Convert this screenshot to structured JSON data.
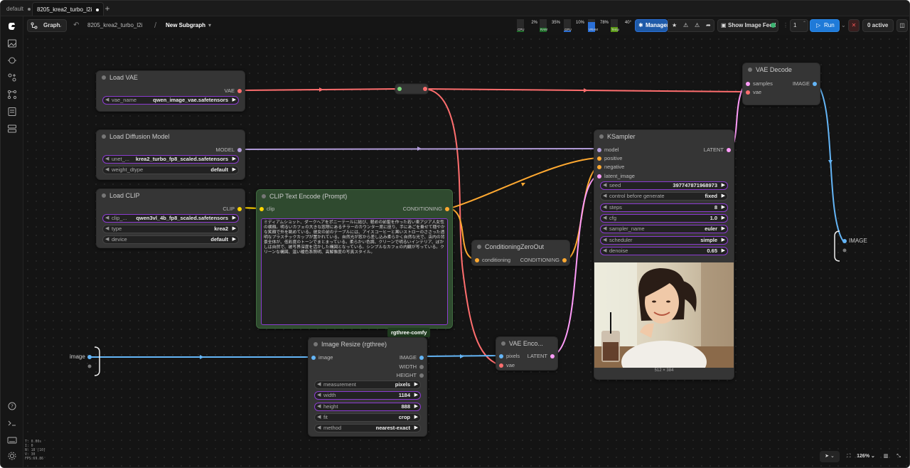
{
  "tabs": [
    {
      "label": "default",
      "active": false
    },
    {
      "label": "8205_krea2_turbo_l2i",
      "active": true
    }
  ],
  "toolbar": {
    "graph_label": "Graph",
    "workflow_name": "8205_krea2_turbo_l2i",
    "separator": "/",
    "subgraph_label": "New Subgraph",
    "resources": [
      {
        "name": "CPU",
        "pct": "2%",
        "color": "#1f6b2a",
        "level": 0.02
      },
      {
        "name": "RAM",
        "pct": "35%",
        "color": "#1f6b2a",
        "level": 0.35
      },
      {
        "name": "GPU",
        "pct": "10%",
        "color": "#2a6fd6",
        "level": 0.1
      },
      {
        "name": "VRAM",
        "pct": "78%",
        "color": "#2a6fd6",
        "level": 0.78
      },
      {
        "name": "Temp",
        "pct": "40°",
        "color": "#5c9a18",
        "level": 0.4
      }
    ],
    "manager_label": "Manager",
    "image_feed_label": "Show Image Feed",
    "batch_value": "1",
    "run_label": "Run",
    "active_label": "0 active"
  },
  "nodes": {
    "load_vae": {
      "title": "Load VAE",
      "out": "VAE",
      "widgets": [
        {
          "name": "vae_name",
          "value": "qwen_image_vae.safetensors"
        }
      ]
    },
    "load_diffusion": {
      "title": "Load Diffusion Model",
      "out": "MODEL",
      "widgets": [
        {
          "name": "unet_...",
          "value": "krea2_turbo_fp8_scaled.safetensors"
        },
        {
          "name": "weight_dtype",
          "value": "default"
        }
      ]
    },
    "load_clip": {
      "title": "Load CLIP",
      "out": "CLIP",
      "widgets": [
        {
          "name": "clip_...",
          "value": "qwen3vl_4b_fp8_scaled.safetensors"
        },
        {
          "name": "type",
          "value": "krea2"
        },
        {
          "name": "device",
          "value": "default"
        }
      ]
    },
    "clip_text": {
      "title": "CLIP Text Encode (Prompt)",
      "in": "clip",
      "out": "CONDITIONING",
      "text": "ミディアムショット、ダークヘアをポニーテールに結び、軽めの前髪を作った若い東アジア人女性の横顔。明るいカフェの大きな窓際にあるチラーのカウンター席に座り、手にあごを乗せて穏やかな笑顔で外を眺めている。彼女の前のテーブルには、アイスコーヒーと黒いストローのささった透明なプラスチックカップが置かれている。自然光が窓から差し込み柔らかく自然な光で、店内の背景全体が、低彩度のトーンでまとまっている。柔らかい色調、クリーンで明るいインテリア、ぼかしは自然で、被写界深度を活かした構図となっている。シンプルなカフェの内観が写っている。クリーンな構図、温い暖色系照明、高解像度の写真スタイル。",
      "badge": "rgthree-comfy"
    },
    "zero_out": {
      "title": "ConditioningZeroOut",
      "in": "conditioning",
      "out": "CONDITIONING"
    },
    "ksampler": {
      "title": "KSampler",
      "inputs": [
        "model",
        "positive",
        "negative",
        "latent_image"
      ],
      "out": "LATENT",
      "widgets": [
        {
          "name": "seed",
          "value": "397747871968973"
        },
        {
          "name": "control before generate",
          "value": "fixed"
        },
        {
          "name": "steps",
          "value": "8"
        },
        {
          "name": "cfg",
          "value": "1.0"
        },
        {
          "name": "sampler_name",
          "value": "euler"
        },
        {
          "name": "scheduler",
          "value": "simple"
        },
        {
          "name": "denoise",
          "value": "0.65"
        }
      ],
      "preview_size": "512 × 384"
    },
    "vae_decode": {
      "title": "VAE Decode",
      "inputs": [
        "samples",
        "vae"
      ],
      "out": "IMAGE"
    },
    "vae_encode": {
      "title": "VAE Enco...",
      "inputs": [
        "pixels",
        "vae"
      ],
      "out": "LATENT"
    },
    "image_resize": {
      "title": "Image Resize (rgthree)",
      "in": "image",
      "outs": [
        "IMAGE",
        "WIDTH",
        "HEIGHT"
      ],
      "widgets": [
        {
          "name": "measurement",
          "value": "pixels"
        },
        {
          "name": "width",
          "value": "1184"
        },
        {
          "name": "height",
          "value": "888"
        },
        {
          "name": "fit",
          "value": "crop"
        },
        {
          "name": "method",
          "value": "nearest-exact"
        }
      ]
    }
  },
  "subgraph_io": {
    "input_label": "image",
    "output_label": "IMAGE"
  },
  "status_info": [
    "T: 0.00s",
    "I: 0",
    "N: 18 [10]",
    "V: 30",
    "FPS:69.86"
  ],
  "bottom_right": {
    "zoom": "126%"
  },
  "colors": {
    "vae": "#ff6e6e",
    "model": "#b39ddb",
    "clip": "#ffd500",
    "conditioning": "#ffa931",
    "latent": "#ff9cf9",
    "image": "#64b5f6"
  }
}
